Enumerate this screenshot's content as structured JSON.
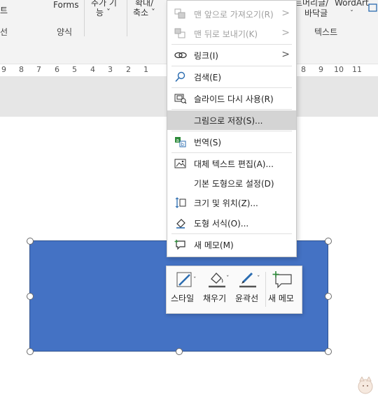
{
  "ribbon": {
    "top_left_fragment": "트",
    "forms": "Forms",
    "add_feature_line1": "추가 기",
    "add_feature_line2": "능 ˇ",
    "zoom_line1": "확대/",
    "zoom_line2": "축소 ˇ",
    "group_left": "선",
    "group_style": "양식",
    "header_fragment": "트",
    "header_footer_line1": "머리글/",
    "header_footer_line2": "바닥글",
    "wordart": "WordArt",
    "group_text": "텍스트"
  },
  "ruler": {
    "left_ticks": [
      "9",
      "8",
      "7",
      "6",
      "5",
      "4",
      "3",
      "2",
      "1"
    ],
    "right_ticks": [
      "8",
      "9",
      "10",
      "11"
    ]
  },
  "context_menu": {
    "items": [
      {
        "label": "맨 앞으로 가져오기(R)",
        "icon": "bring-to-front-icon",
        "disabled": true,
        "submenu": true
      },
      {
        "label": "맨 뒤로 보내기(K)",
        "icon": "send-to-back-icon",
        "disabled": true,
        "submenu": true
      },
      {
        "label": "링크(I)",
        "icon": "link-icon",
        "disabled": false,
        "submenu": true
      },
      {
        "label": "검색(E)",
        "icon": "search-icon",
        "disabled": false,
        "submenu": false
      },
      {
        "label": "슬라이드 다시 사용(R)",
        "icon": "reuse-slides-icon",
        "disabled": false,
        "submenu": false
      },
      {
        "label": "그림으로 저장(S)...",
        "icon": "",
        "disabled": false,
        "submenu": false,
        "hover": true
      },
      {
        "label": "번역(S)",
        "icon": "translate-icon",
        "disabled": false,
        "submenu": false
      },
      {
        "label": "대체 텍스트 편집(A)...",
        "icon": "alt-text-icon",
        "disabled": false,
        "submenu": false
      },
      {
        "label": "기본 도형으로 설정(D)",
        "icon": "",
        "disabled": false,
        "submenu": false
      },
      {
        "label": "크기 및 위치(Z)...",
        "icon": "size-position-icon",
        "disabled": false,
        "submenu": false
      },
      {
        "label": "도형 서식(O)...",
        "icon": "format-shape-icon",
        "disabled": false,
        "submenu": false
      },
      {
        "label": "새 메모(M)",
        "icon": "new-comment-icon",
        "disabled": false,
        "submenu": false
      }
    ]
  },
  "mini_toolbar": {
    "style": "스타일",
    "fill": "채우기",
    "outline": "윤곽선",
    "new_comment": "새 메모"
  },
  "colors": {
    "shape_fill": "#4472c4",
    "hover_bg": "#d4d4d4",
    "accent_green": "#2e8b3a"
  }
}
